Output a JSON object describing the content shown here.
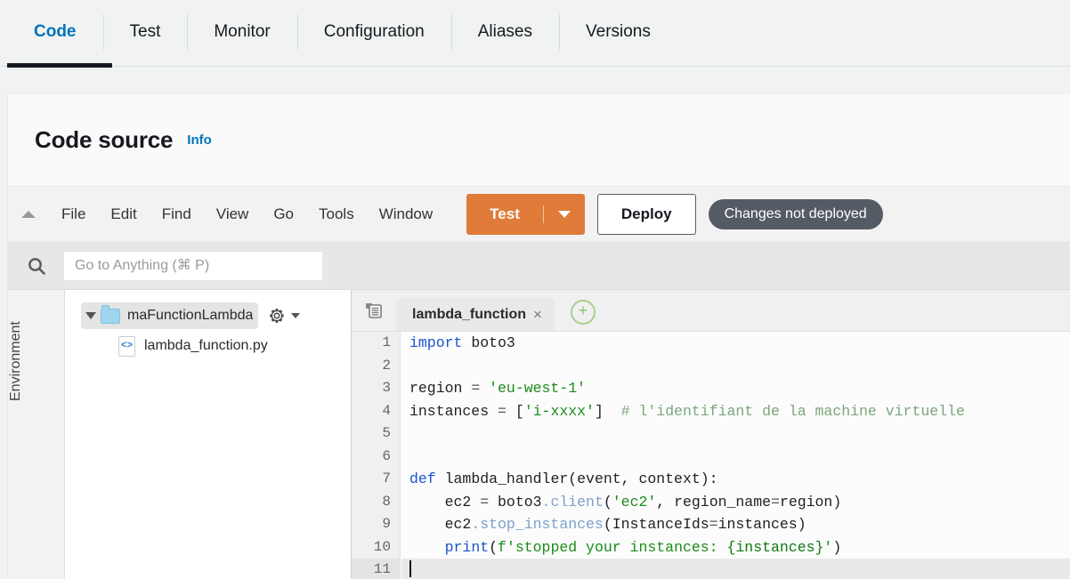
{
  "tabs": [
    {
      "label": "Code",
      "active": true
    },
    {
      "label": "Test",
      "active": false
    },
    {
      "label": "Monitor",
      "active": false
    },
    {
      "label": "Configuration",
      "active": false
    },
    {
      "label": "Aliases",
      "active": false
    },
    {
      "label": "Versions",
      "active": false
    }
  ],
  "card": {
    "title": "Code source",
    "info_link": "Info"
  },
  "ide": {
    "collapse_icon": "triangle-up-icon",
    "menus": [
      "File",
      "Edit",
      "Find",
      "View",
      "Go",
      "Tools",
      "Window"
    ],
    "buttons": {
      "test": "Test",
      "test_caret": "chevron-down-icon",
      "deploy": "Deploy",
      "changes_badge": "Changes not deployed"
    },
    "search": {
      "icon": "search-icon",
      "placeholder": "Go to Anything (⌘ P)",
      "value": ""
    },
    "env_rail_label": "Environment",
    "tree": {
      "folder": {
        "name": "maFunctionLambda",
        "caret_icon": "caret-down-icon",
        "folder_icon": "folder-icon",
        "gear_icon": "gear-icon",
        "gear_caret_icon": "caret-down-icon"
      },
      "file": {
        "name": "lambda_function.py",
        "icon": "code-file-icon",
        "icon_glyph": "<>"
      }
    },
    "editor": {
      "doc_icon": "file-list-icon",
      "tab_label": "lambda_function",
      "tab_close": "×",
      "add_tab": "+",
      "cursor_line": 11,
      "line_numbers": [
        1,
        2,
        3,
        4,
        5,
        6,
        7,
        8,
        9,
        10,
        11
      ],
      "code_colors": {
        "keyword": "#1a53cf",
        "string": "#1a8c1a",
        "comment": "#7ba57b",
        "method": "#7e9fcb"
      },
      "lines": [
        {
          "n": 1,
          "text": "import boto3"
        },
        {
          "n": 2,
          "text": ""
        },
        {
          "n": 3,
          "text": "region = 'eu-west-1'"
        },
        {
          "n": 4,
          "text": "instances = ['i-xxxx']  # l'identifiant de la machine virtuelle"
        },
        {
          "n": 5,
          "text": ""
        },
        {
          "n": 6,
          "text": ""
        },
        {
          "n": 7,
          "text": "def lambda_handler(event, context):"
        },
        {
          "n": 8,
          "text": "    ec2 = boto3.client('ec2', region_name=region)"
        },
        {
          "n": 9,
          "text": "    ec2.stop_instances(InstanceIds=instances)"
        },
        {
          "n": 10,
          "text": "    print(f'stopped your instances: {instances}')"
        },
        {
          "n": 11,
          "text": ""
        }
      ]
    }
  },
  "colors": {
    "accent_blue": "#0073bb",
    "test_orange": "#e07b39",
    "badge_gray": "#545b64"
  }
}
